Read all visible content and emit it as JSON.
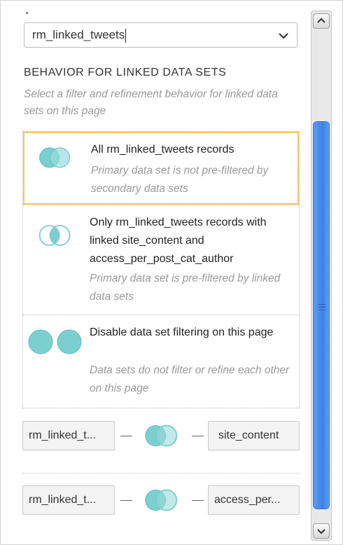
{
  "select": {
    "value": "rm_linked_tweets"
  },
  "behavior": {
    "heading": "BEHAVIOR FOR LINKED DATA SETS",
    "subtext": "Select a filter and refinement behavior for linked data sets on this page",
    "options": [
      {
        "title": "All rm_linked_tweets records",
        "desc": "Primary data set is not pre-filtered by secondary data sets",
        "selected": true
      },
      {
        "title": "Only rm_linked_tweets records with linked site_content and access_per_post_cat_author",
        "desc": "Primary data set is pre-filtered by linked data sets",
        "selected": false
      },
      {
        "title": "Disable data set filtering on this page",
        "desc": "Data sets do not filter or refine each other on this page",
        "selected": false
      }
    ]
  },
  "links": [
    {
      "left": "rm_linked_t...",
      "right": "site_content"
    },
    {
      "left": "rm_linked_t...",
      "right": "access_per..."
    }
  ],
  "colors": {
    "accent_teal": "#7ccfcf",
    "selected_border": "#f5c76a",
    "scroll_thumb": "#4a8ee8"
  },
  "icons": {
    "dropdown": "chevron-down-icon",
    "opt1": "venn-overlap-filled-icon",
    "opt2": "venn-overlap-outline-icon",
    "opt3": "two-circles-separate-icon",
    "link": "venn-link-icon"
  }
}
